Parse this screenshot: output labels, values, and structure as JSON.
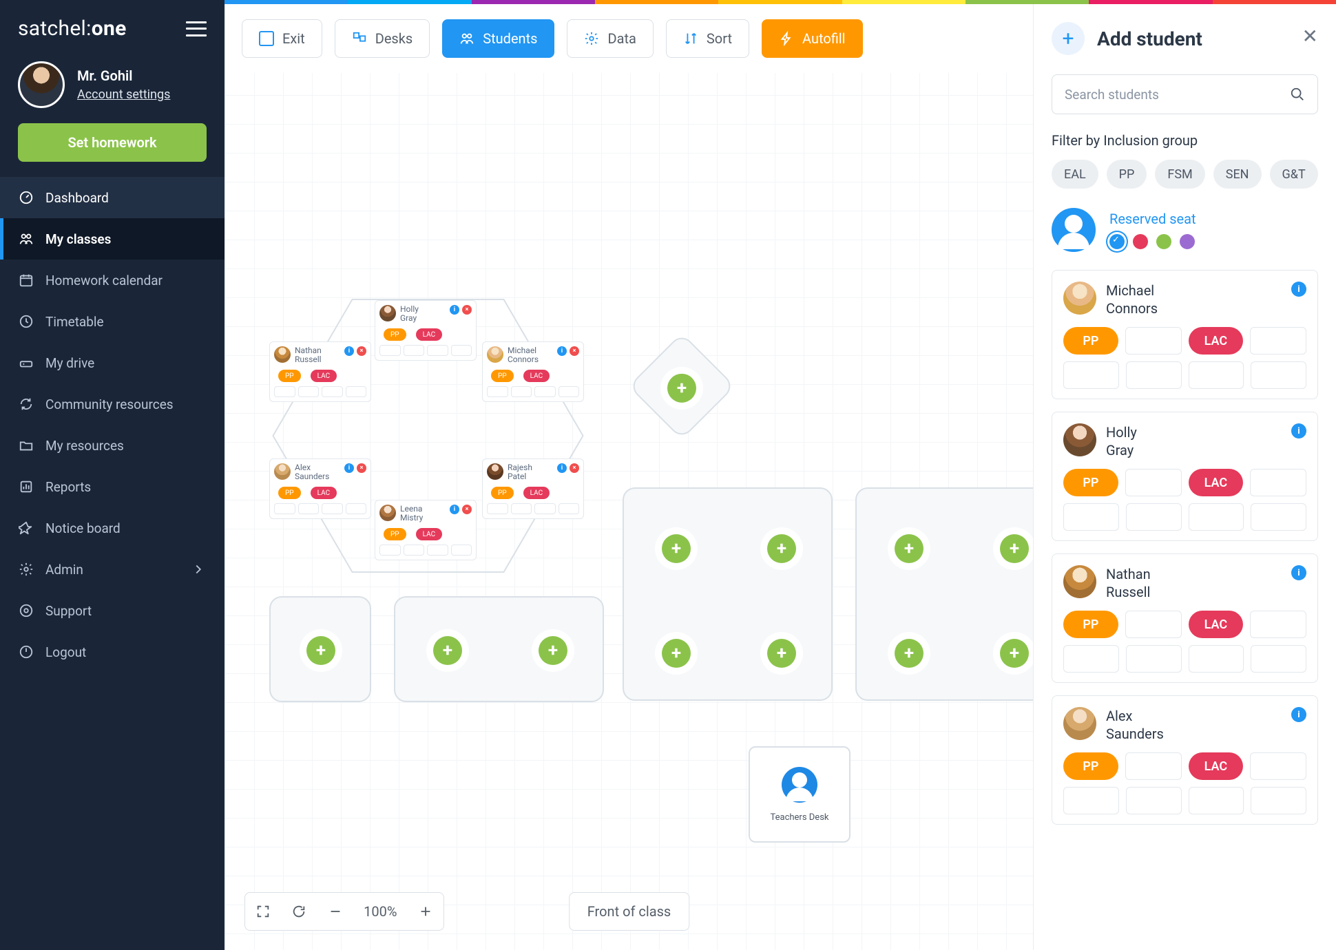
{
  "rainbow": [
    "#2196f3",
    "#03a9f4",
    "#9c27b0",
    "#ff9800",
    "#ffc107",
    "#ffeb3b",
    "#8bc34a",
    "#e91e63",
    "#f44336"
  ],
  "brand": {
    "a": "satchel:",
    "b": "one"
  },
  "user": {
    "name": "Mr. Gohil",
    "settings": "Account settings"
  },
  "primary_action": "Set homework",
  "nav": [
    {
      "key": "dashboard",
      "label": "Dashboard"
    },
    {
      "key": "my-classes",
      "label": "My classes"
    },
    {
      "key": "homework-calendar",
      "label": "Homework calendar"
    },
    {
      "key": "timetable",
      "label": "Timetable"
    },
    {
      "key": "my-drive",
      "label": "My drive"
    },
    {
      "key": "community-resources",
      "label": "Community resources"
    },
    {
      "key": "my-resources",
      "label": "My resources"
    },
    {
      "key": "reports",
      "label": "Reports"
    },
    {
      "key": "notice-board",
      "label": "Notice board"
    },
    {
      "key": "admin",
      "label": "Admin"
    },
    {
      "key": "support",
      "label": "Support"
    },
    {
      "key": "logout",
      "label": "Logout"
    }
  ],
  "toolbar": {
    "exit": "Exit",
    "desks": "Desks",
    "students": "Students",
    "data": "Data",
    "sort": "Sort",
    "autofill": "Autofill"
  },
  "zoom": {
    "value": "100%"
  },
  "front_label": "Front of class",
  "teacher_desk": "Teachers Desk",
  "seats": [
    {
      "first": "Holly",
      "last": "Gray",
      "pp": "PP",
      "lac": "LAC"
    },
    {
      "first": "Nathan",
      "last": "Russell",
      "pp": "PP",
      "lac": "LAC"
    },
    {
      "first": "Michael",
      "last": "Connors",
      "pp": "PP",
      "lac": "LAC"
    },
    {
      "first": "Alex",
      "last": "Saunders",
      "pp": "PP",
      "lac": "LAC"
    },
    {
      "first": "Rajesh",
      "last": "Patel",
      "pp": "PP",
      "lac": "LAC"
    },
    {
      "first": "Leena",
      "last": "Mistry",
      "pp": "PP",
      "lac": "LAC"
    }
  ],
  "right": {
    "title": "Add student",
    "search_placeholder": "Search students",
    "filter_label": "Filter by Inclusion group",
    "pills": [
      "EAL",
      "PP",
      "FSM",
      "SEN",
      "G&T"
    ],
    "reserved_label": "Reserved seat",
    "colors": [
      "#2196f3",
      "#e53a5b",
      "#8bc34a",
      "#9c6bd1"
    ],
    "students": [
      {
        "first": "Michael",
        "last": "Connors",
        "pp": "PP",
        "lac": "LAC"
      },
      {
        "first": "Holly",
        "last": "Gray",
        "pp": "PP",
        "lac": "LAC"
      },
      {
        "first": "Nathan",
        "last": "Russell",
        "pp": "PP",
        "lac": "LAC"
      },
      {
        "first": "Alex",
        "last": "Saunders",
        "pp": "PP",
        "lac": "LAC"
      }
    ]
  }
}
